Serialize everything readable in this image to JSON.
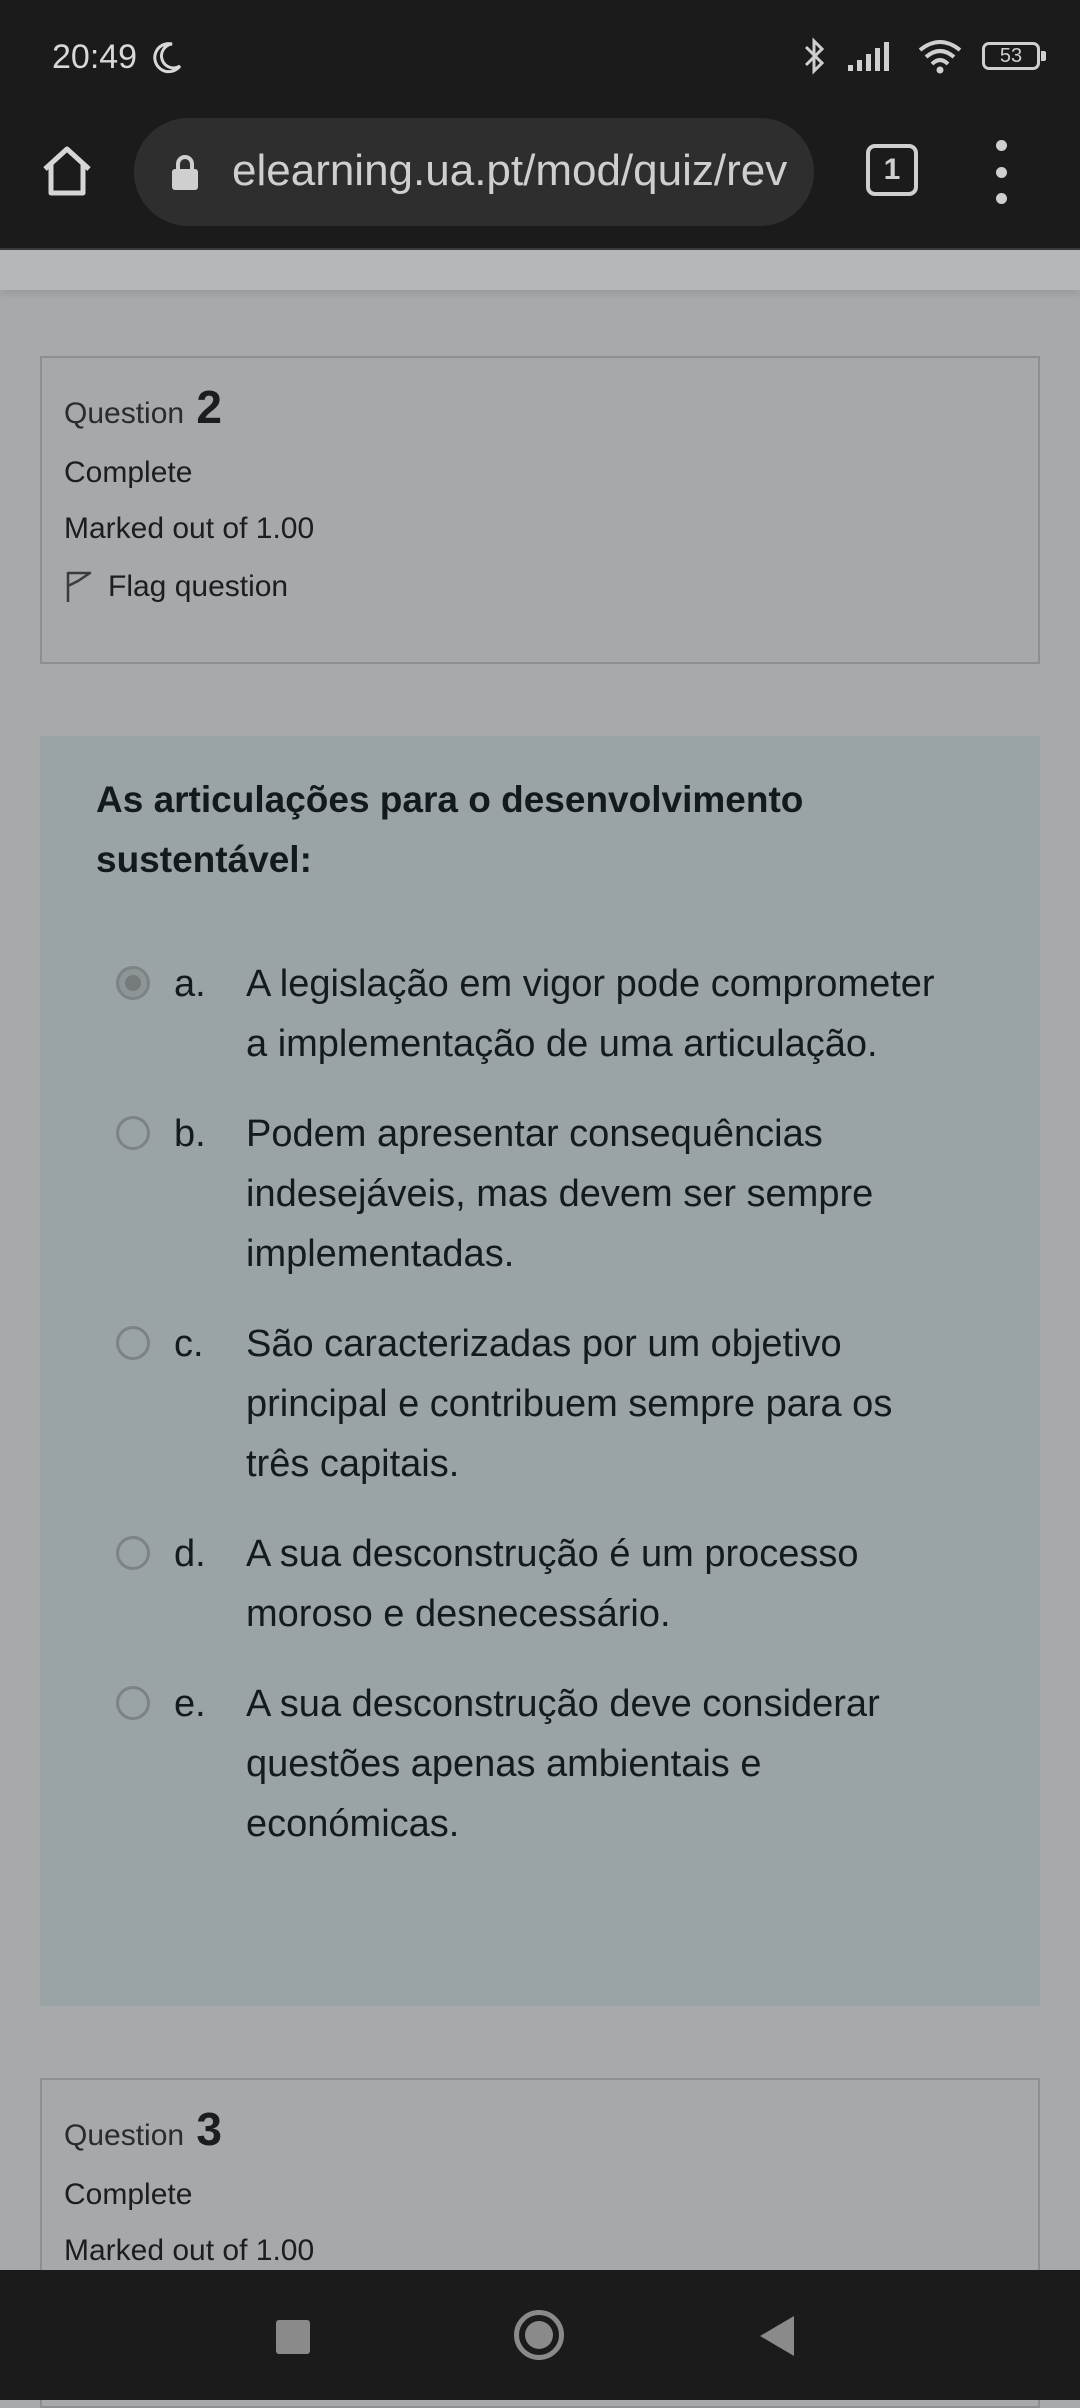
{
  "status": {
    "time": "20:49",
    "battery": "53",
    "icons": [
      "moon-icon",
      "bluetooth-icon",
      "signal-icon",
      "wifi-icon",
      "battery-icon"
    ]
  },
  "browser": {
    "url": "elearning.ua.pt/mod/quiz/rev",
    "tab_count": "1"
  },
  "question2": {
    "label": "Question",
    "number": "2",
    "state": "Complete",
    "mark": "Marked out of 1.00",
    "flag": "Flag question"
  },
  "question_text": "As articulações para o desenvolvimento sustentável:",
  "answers": [
    {
      "letter": "a.",
      "text": "A legislação em vigor pode comprometer a implementação de uma articulação.",
      "selected": true
    },
    {
      "letter": "b.",
      "text": "Podem apresentar consequências indesejáveis, mas devem ser sempre implementadas.",
      "selected": false
    },
    {
      "letter": "c.",
      "text": "São caracterizadas por um objetivo principal e contribuem sempre para os três capitais.",
      "selected": false
    },
    {
      "letter": "d.",
      "text": "A sua desconstrução é um processo moroso e desnecessário.",
      "selected": false
    },
    {
      "letter": "e.",
      "text": "A sua desconstrução deve considerar questões apenas ambientais e económicas.",
      "selected": false
    }
  ],
  "question3": {
    "label": "Question",
    "number": "3",
    "state": "Complete",
    "mark": "Marked out of 1.00"
  }
}
